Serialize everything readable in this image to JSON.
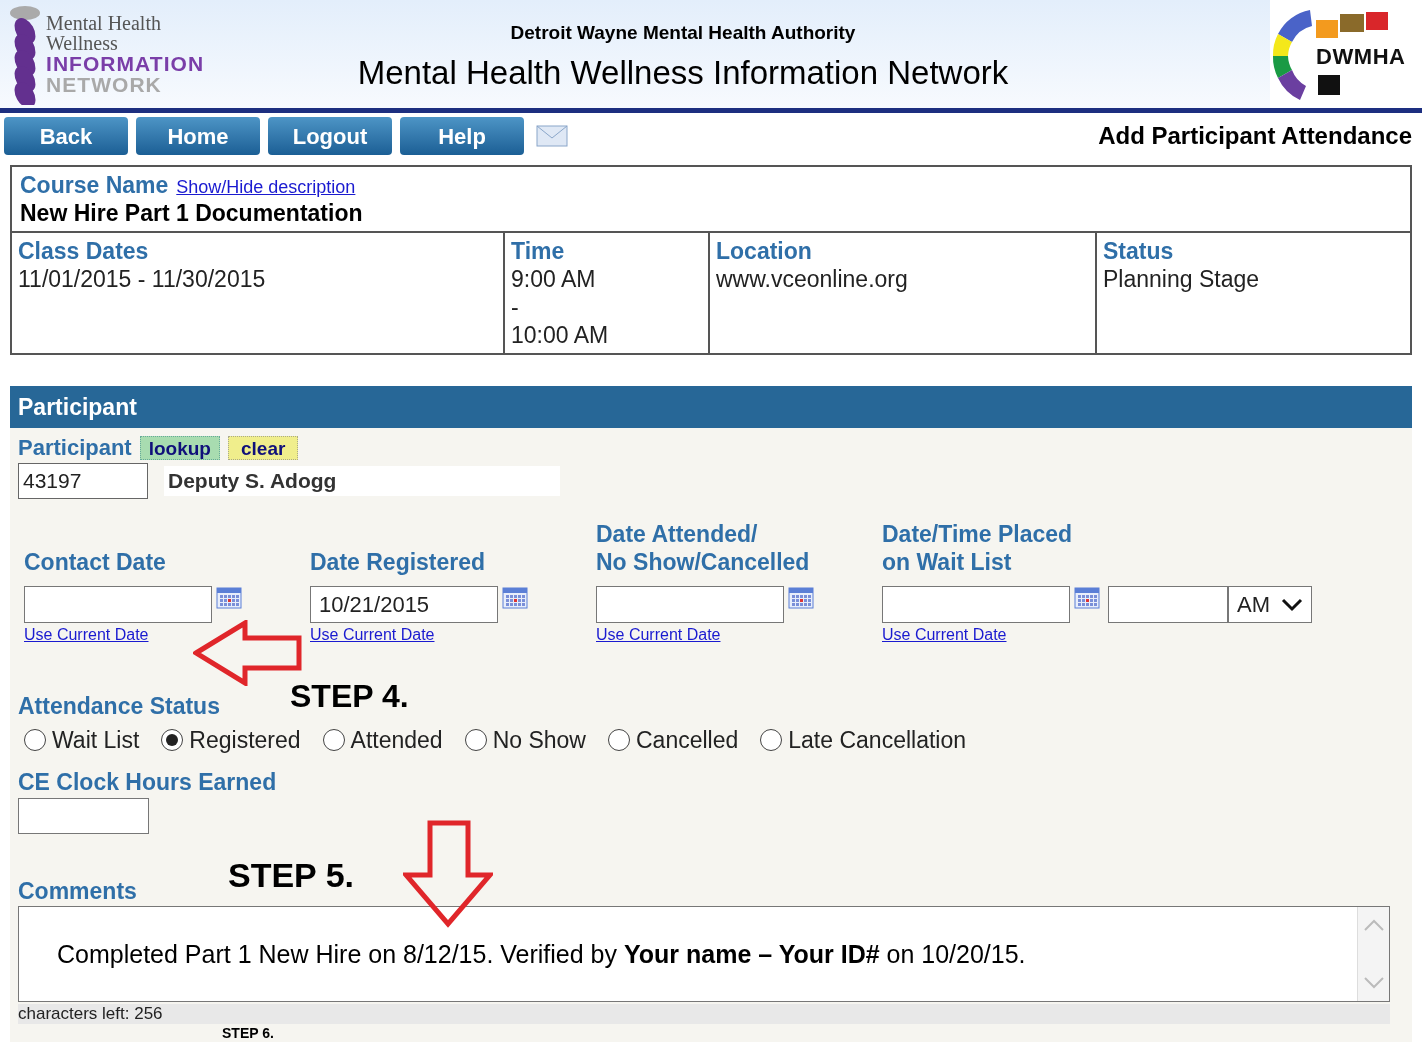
{
  "header": {
    "logo_lines": [
      "Mental Health",
      "Wellness",
      "INFORMATION",
      "NETWORK"
    ],
    "org": "Detroit Wayne Mental Health Authority",
    "title": "Mental Health Wellness Information Network",
    "right_logo": "DWMHA"
  },
  "nav": {
    "buttons": [
      "Back",
      "Home",
      "Logout",
      "Help"
    ],
    "page_title": "Add Participant Attendance"
  },
  "course": {
    "name_label": "Course Name",
    "toggle_link": "Show/Hide description",
    "name": "New Hire Part 1 Documentation",
    "columns": [
      {
        "label": "Class Dates",
        "lines": [
          "11/01/2015 - 11/30/2015"
        ]
      },
      {
        "label": "Time",
        "lines": [
          "9:00 AM",
          "-",
          "10:00 AM"
        ]
      },
      {
        "label": "Location",
        "lines": [
          "www.vceonline.org"
        ]
      },
      {
        "label": "Status",
        "lines": [
          "Planning Stage"
        ]
      }
    ]
  },
  "participant": {
    "section_title": "Participant",
    "label": "Participant",
    "lookup": "lookup",
    "clear": "clear",
    "id_value": "43197",
    "name": "Deputy S. Adogg"
  },
  "dates": [
    {
      "kind": "date",
      "label_lines": [
        "Contact Date"
      ],
      "link": "Use Current Date"
    },
    {
      "kind": "date",
      "label_lines": [
        "Date Registered"
      ],
      "value": "10/21/2015",
      "link": "Use Current Date"
    },
    {
      "kind": "date",
      "label_lines": [
        "Date Attended/",
        "No Show/Cancelled"
      ],
      "link": "Use Current Date"
    },
    {
      "kind": "datetime",
      "label_lines": [
        "Date/Time Placed",
        "on Wait List"
      ],
      "ampm": "AM",
      "link": "Use Current Date"
    }
  ],
  "attendance": {
    "label": "Attendance Status",
    "options": [
      {
        "label": "Wait List",
        "selected": false
      },
      {
        "label": "Registered",
        "selected": true
      },
      {
        "label": "Attended",
        "selected": false
      },
      {
        "label": "No Show",
        "selected": false
      },
      {
        "label": "Cancelled",
        "selected": false
      },
      {
        "label": "Late Cancellation",
        "selected": false
      }
    ]
  },
  "ce_hours": {
    "label": "CE Clock Hours Earned"
  },
  "comments": {
    "label": "Comments",
    "text": "Completed Part 1 New Hire on 8/12/15. Verified by **Your name – Your ID#** on 10/20/15.",
    "chars_left": "characters left: 256"
  },
  "steps": [
    "STEP 4.",
    "STEP 5.",
    "STEP 6."
  ]
}
